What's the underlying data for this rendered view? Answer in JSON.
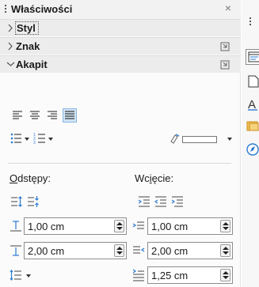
{
  "panel": {
    "title": "Właściwości",
    "close_glyph": "×",
    "sections": {
      "styl": "Styl",
      "znak": "Znak",
      "akapit": "Akapit"
    }
  },
  "paragraph": {
    "spacing_label_prefix": "O",
    "spacing_label_rest": "dstępy:",
    "indent_label_prefix": "Wc",
    "indent_label_accel": "i",
    "indent_label_rest": "ęcie:",
    "above_value": "1,00 cm",
    "below_value": "2,00 cm",
    "before_text_value": "1,00 cm",
    "after_text_value": "2,00 cm",
    "first_line_value": "1,25 cm",
    "alignment_selected": "justified",
    "highlight_color": "#ffffff"
  },
  "icons": {
    "align": [
      "align-left-icon",
      "align-center-icon",
      "align-right-icon",
      "align-justify-icon"
    ],
    "tabs": [
      "properties-tab-icon",
      "page-tab-icon",
      "styles-tab-icon",
      "gallery-tab-icon",
      "navigator-tab-icon"
    ]
  },
  "colors": {
    "accent": "#2a7bd4",
    "active_bg": "#cfe3f6",
    "header_bg": "#ececec"
  }
}
